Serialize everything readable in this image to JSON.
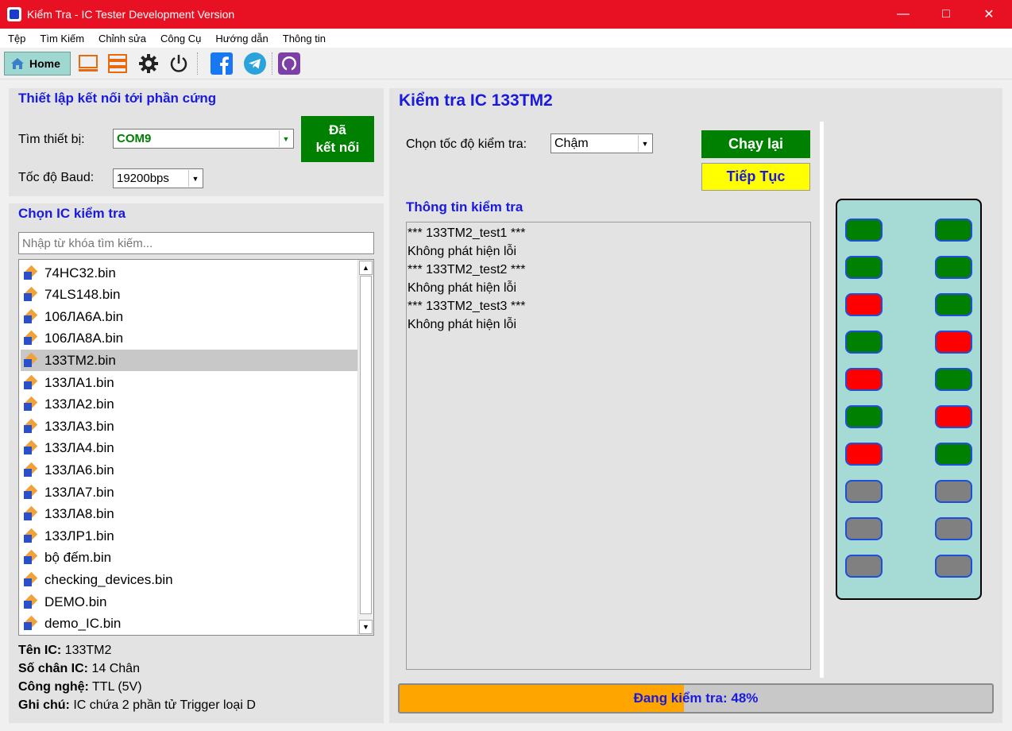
{
  "window": {
    "title": "Kiểm Tra - IC Tester Development Version"
  },
  "menu": [
    "Tệp",
    "Tìm Kiếm",
    "Chỉnh sửa",
    "Công Cụ",
    "Hướng dẫn",
    "Thông tin"
  ],
  "toolbar": {
    "home_label": "Home"
  },
  "connection": {
    "title": "Thiết lập kết nối tới phần cứng",
    "device_label": "Tìm thiết bị:",
    "device_value": "COM9",
    "baud_label": "Tốc độ Baud:",
    "baud_value": "19200bps",
    "status_line1": "Đã",
    "status_line2": "kết nối"
  },
  "ic_select": {
    "title": "Chọn IC kiểm tra",
    "search_placeholder": "Nhập từ khóa tìm kiếm...",
    "items": [
      "74HC32.bin",
      "74LS148.bin",
      "106ЛА6А.bin",
      "106ЛА8А.bin",
      "133TM2.bin",
      "133ЛА1.bin",
      "133ЛА2.bin",
      "133ЛА3.bin",
      "133ЛА4.bin",
      "133ЛА6.bin",
      "133ЛА7.bin",
      "133ЛА8.bin",
      "133ЛР1.bin",
      "bộ đếm.bin",
      "checking_devices.bin",
      "DEMO.bin",
      "demo_IC.bin"
    ],
    "selected_index": 4
  },
  "ic_info": {
    "name_label": "Tên IC:",
    "name_value": "133TM2",
    "pins_label": "Số chân IC:",
    "pins_value": "14 Chân",
    "tech_label": "Công nghệ:",
    "tech_value": "TTL (5V)",
    "note_label": "Ghi chú:",
    "note_value": "IC chứa 2 phần tử Trigger loại D"
  },
  "test": {
    "title": "Kiểm tra IC 133TM2",
    "speed_label": "Chọn tốc độ kiểm tra:",
    "speed_value": "Chậm",
    "rerun_label": "Chạy lại",
    "continue_label": "Tiếp Tục",
    "log_title": "Thông tin kiểm tra",
    "log_lines": [
      "*** 133TM2_test1 ***",
      "Không phát hiện lỗi",
      "*** 133TM2_test2 ***",
      "Không phát hiện lỗi",
      "*** 133TM2_test3 ***",
      "Không phát hiện lỗi"
    ],
    "progress_percent": 48,
    "progress_text": "Đang kiểm tra: 48%"
  },
  "ic_pins": {
    "left": [
      "green",
      "green",
      "red",
      "green",
      "red",
      "green",
      "red",
      "gray",
      "gray",
      "gray"
    ],
    "right": [
      "green",
      "green",
      "green",
      "red",
      "green",
      "red",
      "green",
      "gray",
      "gray",
      "gray"
    ]
  },
  "colors": {
    "green": "#008000",
    "red": "#ff0000",
    "gray": "#808080",
    "accent": "#1a1adc",
    "titlebar": "#e81123"
  }
}
